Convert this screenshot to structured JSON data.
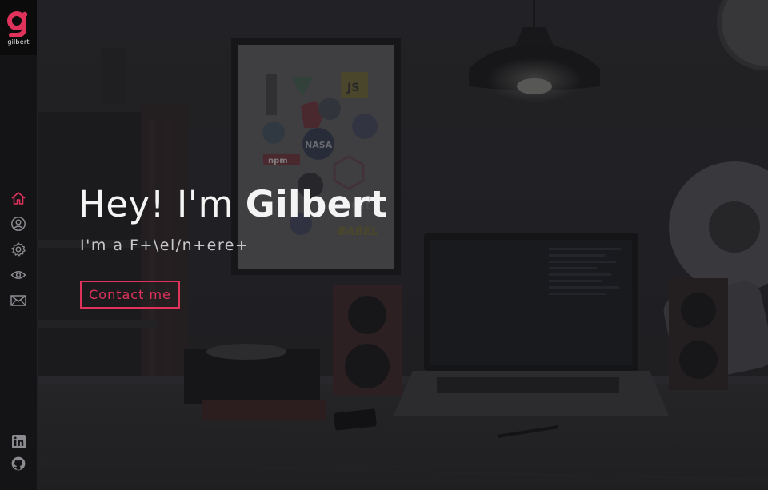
{
  "brand": {
    "logo_text": "gilbert",
    "accent_color": "#e0335b"
  },
  "nav": {
    "items": [
      {
        "icon": "home-icon",
        "active": true
      },
      {
        "icon": "user-icon",
        "active": false
      },
      {
        "icon": "gear-icon",
        "active": false
      },
      {
        "icon": "eye-icon",
        "active": false
      },
      {
        "icon": "mail-icon",
        "active": false
      }
    ]
  },
  "social": {
    "items": [
      {
        "icon": "linkedin-icon"
      },
      {
        "icon": "github-icon"
      }
    ]
  },
  "hero": {
    "greeting": "Hey! I'm ",
    "name": "Gilbert",
    "subtitle": "I'm a F+\\el/n+ere+",
    "contact_label": "Contact me"
  },
  "poster": {
    "logos": [
      "JS",
      "NASA",
      "npm",
      "git",
      "BABEL"
    ]
  }
}
